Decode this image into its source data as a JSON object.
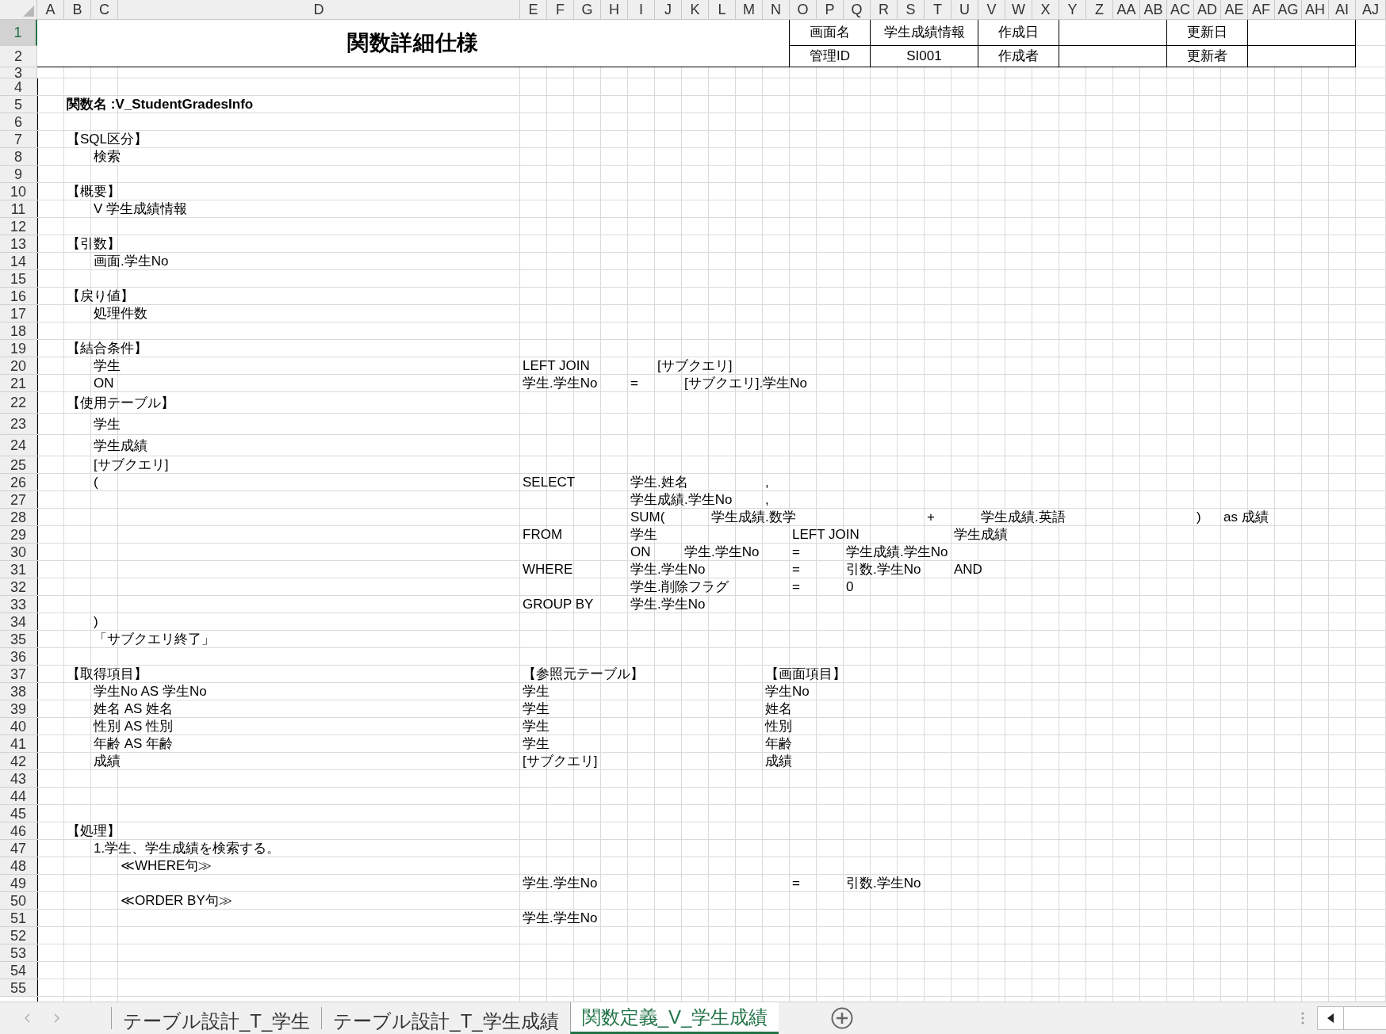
{
  "columns": [
    "A",
    "B",
    "C",
    "D",
    "E",
    "F",
    "G",
    "H",
    "I",
    "J",
    "K",
    "L",
    "M",
    "N",
    "O",
    "P",
    "Q",
    "R",
    "S",
    "T",
    "U",
    "V",
    "W",
    "X",
    "Y",
    "Z",
    "AA",
    "AB",
    "AC",
    "AD",
    "AE",
    "AF",
    "AG",
    "AH",
    "AI",
    "AJ"
  ],
  "header": {
    "title": "関数詳細仕様",
    "info": [
      {
        "label": "画面名",
        "value": "学生成績情報"
      },
      {
        "label": "作成日"
      },
      {
        "label": "更新日"
      },
      {
        "label": "管理ID",
        "value": "SI001"
      },
      {
        "label": "作成者"
      },
      {
        "label": "更新者"
      }
    ]
  },
  "rows": [
    {
      "number": "1",
      "selected": true
    },
    {
      "number": "2",
      "selected": false
    },
    {
      "number": "3",
      "selected": false
    },
    {
      "number": "4",
      "selected": false
    },
    {
      "number": "5",
      "selected": false,
      "heading": "関数名 :V_StudentGradesInfo"
    },
    {
      "number": "6",
      "selected": false
    },
    {
      "number": "7",
      "selected": false,
      "cells": {
        "B": "【SQL区分】"
      }
    },
    {
      "number": "8",
      "selected": false,
      "cells": {
        "C": "検索"
      }
    },
    {
      "number": "9",
      "selected": false
    },
    {
      "number": "10",
      "selected": false,
      "cells": {
        "B": "【概要】"
      }
    },
    {
      "number": "11",
      "selected": false,
      "cells": {
        "C": "V 学生成績情報"
      }
    },
    {
      "number": "12",
      "selected": false
    },
    {
      "number": "13",
      "selected": false,
      "cells": {
        "B": "【引数】"
      }
    },
    {
      "number": "14",
      "selected": false,
      "cells": {
        "C": "画面.学生No"
      }
    },
    {
      "number": "15",
      "selected": false
    },
    {
      "number": "16",
      "selected": false,
      "cells": {
        "B": "【戻り値】"
      }
    },
    {
      "number": "17",
      "selected": false,
      "cells": {
        "C": "処理件数"
      }
    },
    {
      "number": "18",
      "selected": false
    },
    {
      "number": "19",
      "selected": false,
      "cells": {
        "B": "【結合条件】"
      }
    },
    {
      "number": "20",
      "selected": false,
      "cells": {
        "C": "学生",
        "E": "LEFT JOIN",
        "J": "[サブクエリ]"
      }
    },
    {
      "number": "21",
      "selected": false,
      "cells": {
        "C": "ON",
        "E": "学生.学生No",
        "I": "=",
        "K": "[サブクエリ].学生No"
      }
    },
    {
      "number": "22",
      "selected": false,
      "cells": {
        "B": "【使用テーブル】"
      }
    },
    {
      "number": "23",
      "selected": false,
      "cells": {
        "C": "学生"
      }
    },
    {
      "number": "24",
      "selected": false,
      "cells": {
        "C": "学生成績"
      }
    },
    {
      "number": "25",
      "selected": false,
      "cells": {
        "C": "[サブクエリ]"
      }
    },
    {
      "number": "26",
      "selected": false,
      "cells": {
        "C": "(",
        "E": "SELECT",
        "I": "学生.姓名",
        "N": ","
      }
    },
    {
      "number": "27",
      "selected": false,
      "cells": {
        "I": "学生成績.学生No",
        "N": ","
      }
    },
    {
      "number": "28",
      "selected": false,
      "cells": {
        "I": "SUM(",
        "L": "学生成績.数学",
        "T": "+",
        "V": "学生成績.英語",
        "AD": ")",
        "AE": "as 成績"
      }
    },
    {
      "number": "29",
      "selected": false,
      "cells": {
        "E": "FROM",
        "I": "学生",
        "O": "LEFT JOIN",
        "U": "学生成績"
      }
    },
    {
      "number": "30",
      "selected": false,
      "cells": {
        "I": "ON",
        "K": "学生.学生No",
        "O": "=",
        "Q": "学生成績.学生No"
      }
    },
    {
      "number": "31",
      "selected": false,
      "cells": {
        "E": "WHERE",
        "I": "学生.学生No",
        "O": "=",
        "Q": "引数.学生No",
        "U": "AND"
      }
    },
    {
      "number": "32",
      "selected": false,
      "cells": {
        "I": "学生.削除フラグ",
        "O": "=",
        "Q": "0"
      }
    },
    {
      "number": "33",
      "selected": false,
      "cells": {
        "E": "GROUP BY",
        "I": "学生.学生No"
      }
    },
    {
      "number": "34",
      "selected": false,
      "cells": {
        "C": ")"
      }
    },
    {
      "number": "35",
      "selected": false,
      "cells": {
        "C": "「サブクエリ終了」"
      }
    },
    {
      "number": "36",
      "selected": false
    },
    {
      "number": "37",
      "selected": false,
      "cells": {
        "B": "【取得項目】",
        "E": "【参照元テーブル】",
        "N": "【画面項目】"
      }
    },
    {
      "number": "38",
      "selected": false,
      "cells": {
        "C": "学生No AS 学生No",
        "E": "学生",
        "N": "学生No"
      }
    },
    {
      "number": "39",
      "selected": false,
      "cells": {
        "C": "姓名 AS 姓名",
        "E": "学生",
        "N": "姓名"
      }
    },
    {
      "number": "40",
      "selected": false,
      "cells": {
        "C": "性別 AS 性別",
        "E": "学生",
        "N": "性別"
      }
    },
    {
      "number": "41",
      "selected": false,
      "cells": {
        "C": "年齢 AS 年齢",
        "E": "学生",
        "N": "年齢"
      }
    },
    {
      "number": "42",
      "selected": false,
      "cells": {
        "C": "成績",
        "E": "[サブクエリ]",
        "N": "成績"
      }
    },
    {
      "number": "43",
      "selected": false
    },
    {
      "number": "44",
      "selected": false
    },
    {
      "number": "45",
      "selected": false
    },
    {
      "number": "46",
      "selected": false,
      "cells": {
        "B": "【処理】"
      }
    },
    {
      "number": "47",
      "selected": false,
      "cells": {
        "C": "1.学生、学生成績を検索する。"
      }
    },
    {
      "number": "48",
      "selected": false,
      "cells": {
        "D": "≪WHERE句≫"
      }
    },
    {
      "number": "49",
      "selected": false,
      "cells": {
        "E": "学生.学生No",
        "O": "=",
        "Q": "引数.学生No"
      }
    },
    {
      "number": "50",
      "selected": false,
      "cells": {
        "D": "≪ORDER BY句≫"
      }
    },
    {
      "number": "51",
      "selected": false,
      "cells": {
        "E": "学生.学生No"
      }
    },
    {
      "number": "52",
      "selected": false
    },
    {
      "number": "53",
      "selected": false
    },
    {
      "number": "54",
      "selected": false
    },
    {
      "number": "55",
      "selected": false
    }
  ],
  "sheet_tabs": [
    {
      "label": "テーブル設計_T_学生",
      "selected": false
    },
    {
      "label": "テーブル設計_T_学生成績",
      "selected": false
    },
    {
      "label": "関数定義_V_学生成績",
      "selected": true
    }
  ]
}
